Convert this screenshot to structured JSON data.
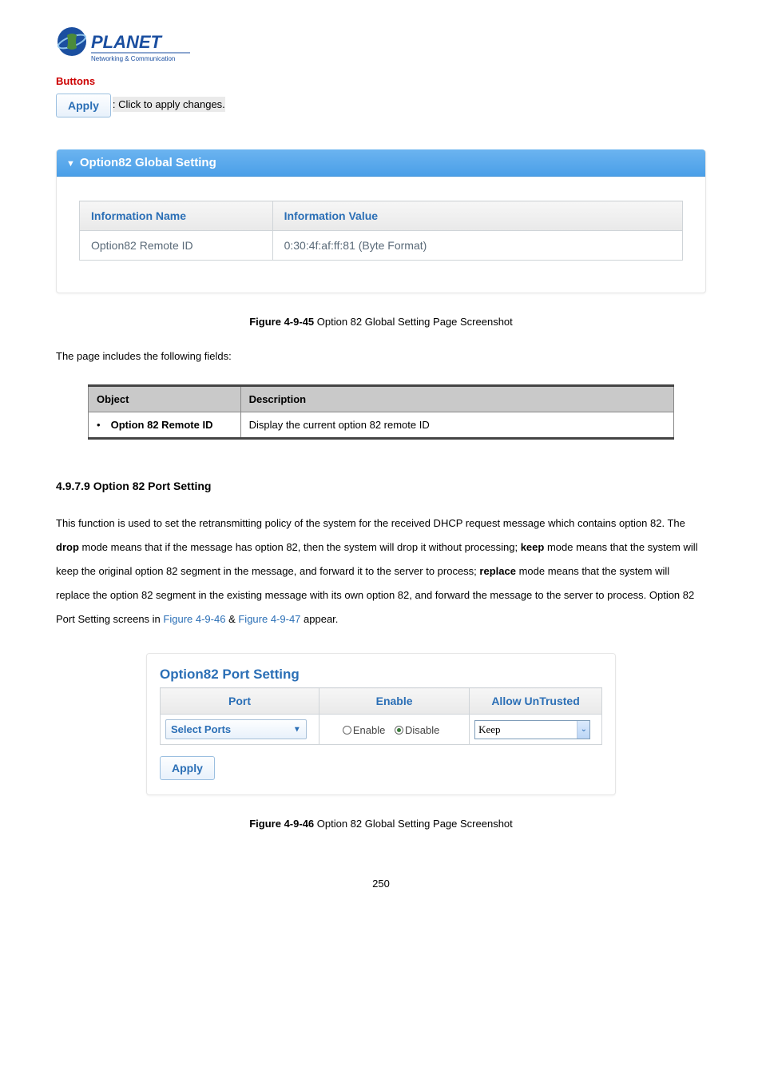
{
  "logo": {
    "brand": "PLANET",
    "tagline": "Networking & Communication"
  },
  "buttons": {
    "heading": "Buttons",
    "apply_label": "Apply",
    "apply_desc": ": Click to apply changes."
  },
  "panel1": {
    "title": "Option82 Global Setting",
    "th_name": "Information Name",
    "th_value": "Information Value",
    "row_name": "Option82 Remote ID",
    "row_value": "0:30:4f:af:ff:81 (Byte Format)"
  },
  "fig45": {
    "label": "Figure 4-9-45",
    "text": " Option 82 Global Setting Page Screenshot"
  },
  "intro_fields": "The page includes the following fields:",
  "desc_table": {
    "th_object": "Object",
    "th_desc": "Description",
    "row1_obj": "Option 82 Remote ID",
    "row1_desc": "Display the current option 82 remote ID"
  },
  "section": {
    "heading": "4.9.7.9 Option 82 Port Setting",
    "p1_a": "This function is used to set the retransmitting policy of the system for the received DHCP request message which contains option 82. The ",
    "p1_drop": "drop",
    "p1_b": " mode means that if the message has option 82, then the system will drop it without processing; ",
    "p1_keep": "keep",
    "p1_c": " mode means that the system will keep the original option 82 segment in the message, and forward it to the server to process; ",
    "p1_replace": "replace",
    "p1_d": " mode means that the system will replace the option 82 segment in the existing message with its own option 82, and forward the message to the server to process. Option 82 Port Setting screens in ",
    "link46": "Figure 4-9-46",
    "amp": " & ",
    "link47": "Figure 4-9-47",
    "p1_e": " appear."
  },
  "port_setting": {
    "title": "Option82 Port Setting",
    "th_port": "Port",
    "th_enable": "Enable",
    "th_allow": "Allow UnTrusted",
    "select_ports": "Select Ports",
    "enable_label": "Enable",
    "disable_label": "Disable",
    "keep": "Keep",
    "apply": "Apply"
  },
  "fig46": {
    "label": "Figure 4-9-46",
    "text": " Option 82 Global Setting Page Screenshot"
  },
  "page_number": "250"
}
